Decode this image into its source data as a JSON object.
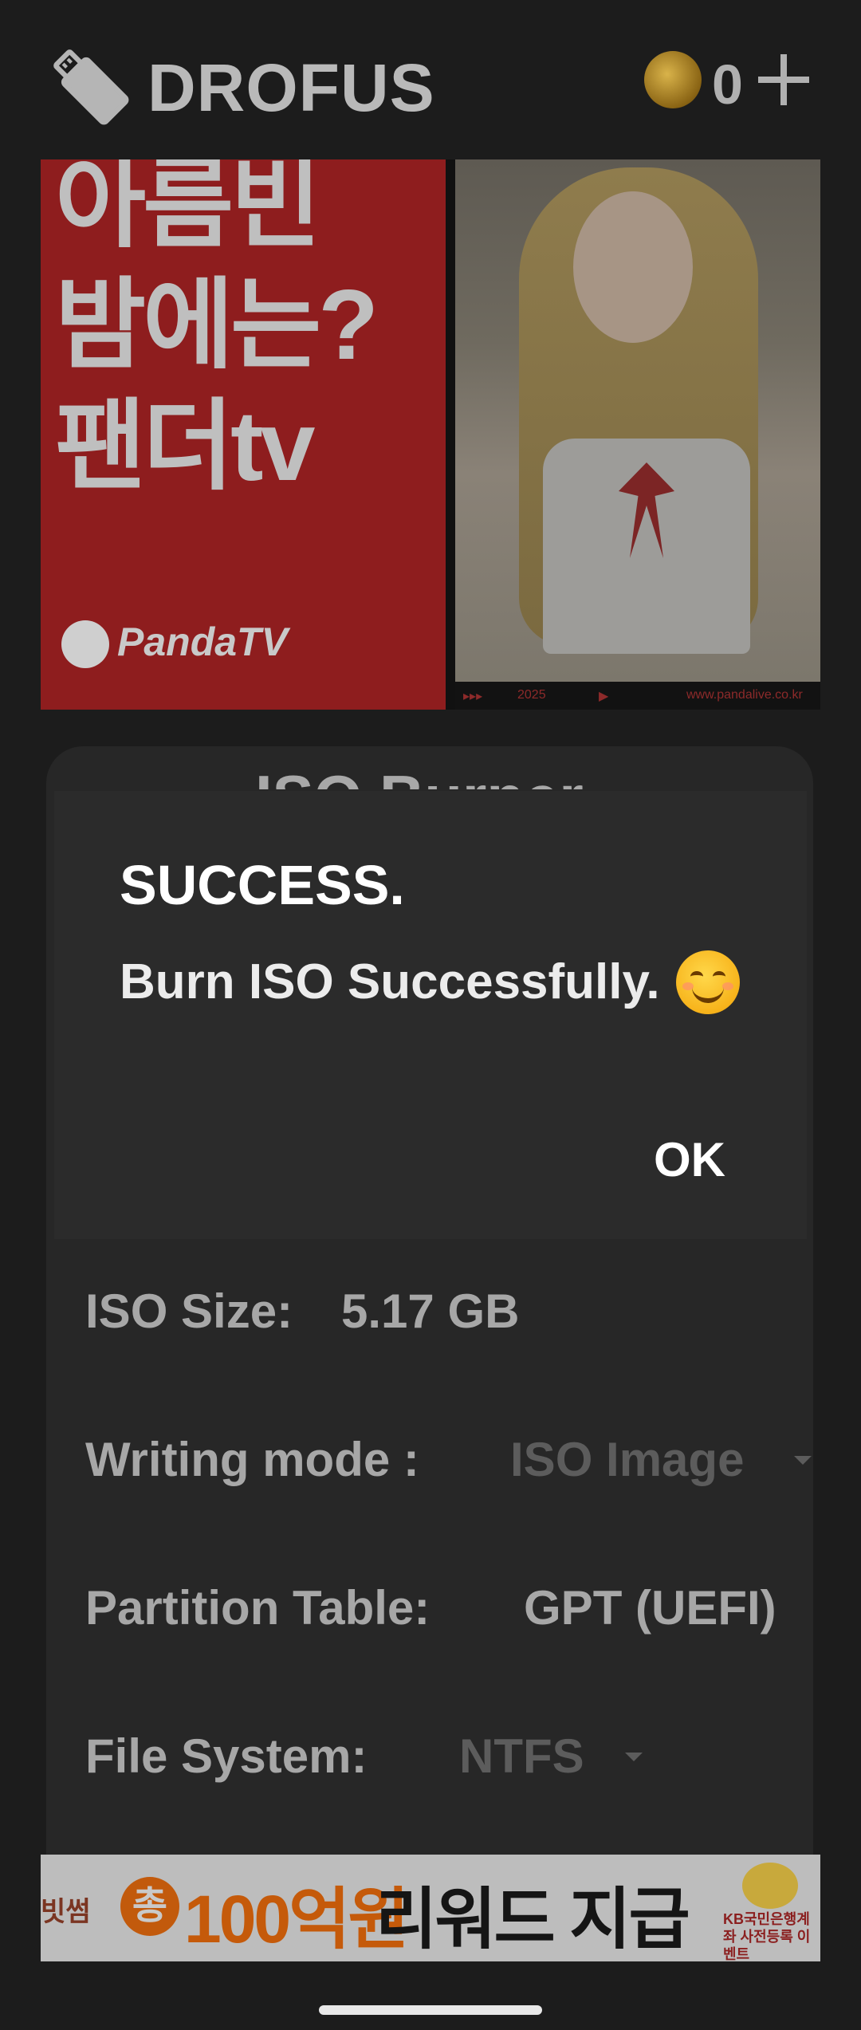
{
  "header": {
    "app_title": "DROFUS",
    "coin_count": "0",
    "icons": {
      "logo": "usb-drive-icon",
      "coin": "coin-icon",
      "add": "plus-icon"
    }
  },
  "ad_top": {
    "headline_lines": [
      "아름빈",
      "밤에는?",
      "팬더tv"
    ],
    "brand": "PandaTV",
    "strip": {
      "left": "▸▸▸",
      "year": "2025",
      "play": "▶",
      "url": "www.pandalive.co.kr"
    }
  },
  "card": {
    "title": "ISO Burner",
    "rows": [
      {
        "label": "ISO Size:",
        "value": "5.17 GB"
      },
      {
        "label": "Writing mode :",
        "value": "ISO Image"
      },
      {
        "label": "Partition Table:",
        "value": "GPT (UEFI)"
      },
      {
        "label": "File System:",
        "value": "NTFS"
      }
    ]
  },
  "dialog": {
    "title": "SUCCESS.",
    "message": "Burn ISO Successfully.",
    "emoji_icon": "smiling-face-icon",
    "ok_label": "OK"
  },
  "ad_bottom": {
    "brand": "빗썸",
    "circle": "총",
    "amount": "100억원",
    "text": "리워드 지급",
    "side_text": "KB국민은행계좌 사전등록 이벤트"
  }
}
